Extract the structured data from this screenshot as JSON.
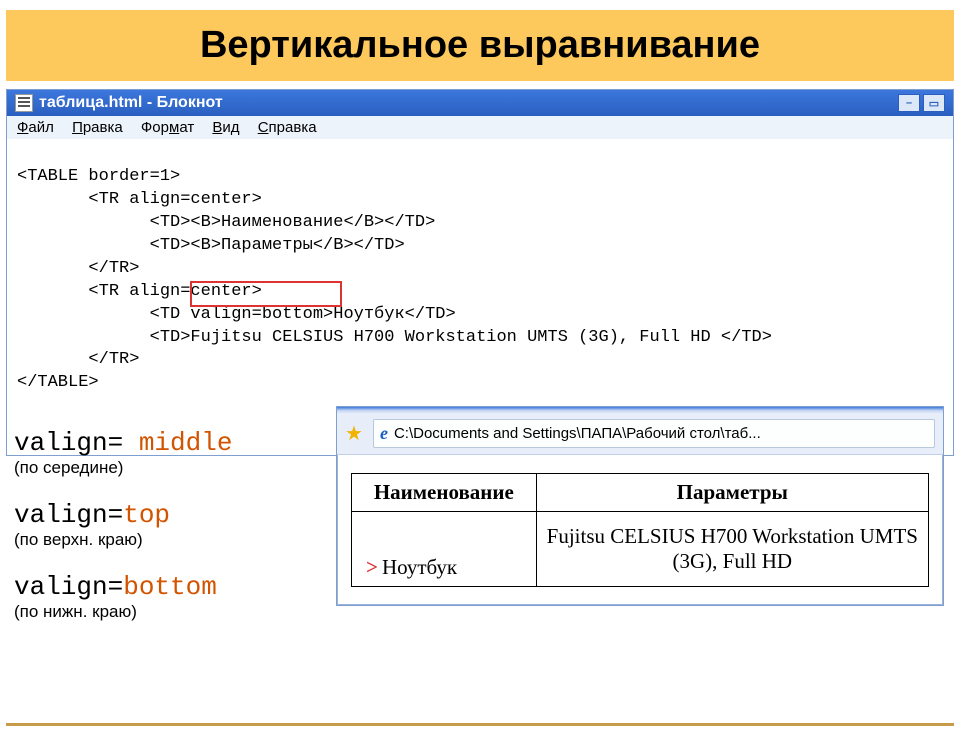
{
  "slide": {
    "title": "Вертикальное выравнивание"
  },
  "notepad": {
    "window_title": "таблица.html - Блокнот",
    "menu": {
      "file": "Файл",
      "edit": "Правка",
      "format": "Формат",
      "view": "Вид",
      "help": "Справка"
    },
    "code_lines": [
      "<TABLE border=1>",
      "       <TR align=center>",
      "             <TD><B>Наименование</B></TD>",
      "             <TD><B>Параметры</B></TD>",
      "       </TR>",
      "       <TR align=center>",
      "             <TD valign=bottom>Ноутбук</TD>",
      "             <TD>Fujitsu CELSIUS H700 Workstation UMTS (3G), Full HD </TD>",
      "       </TR>",
      "</TABLE>"
    ],
    "highlight_text": "valign=bottom"
  },
  "options": [
    {
      "attr": "valign= ",
      "value": "middle",
      "desc": "(по середине)"
    },
    {
      "attr": "valign=",
      "value": "top",
      "desc": "(по верхн. краю)"
    },
    {
      "attr": "valign=",
      "value": "bottom",
      "desc": "(по нижн. краю)"
    }
  ],
  "ie": {
    "url": "C:\\Documents and Settings\\ПАПА\\Рабочий стол\\таб...",
    "table": {
      "headers": [
        "Наименование",
        "Параметры"
      ],
      "row": {
        "col1": "Ноутбук",
        "col2": "Fujitsu CELSIUS H700 Workstation UMTS (3G), Full HD"
      }
    }
  }
}
